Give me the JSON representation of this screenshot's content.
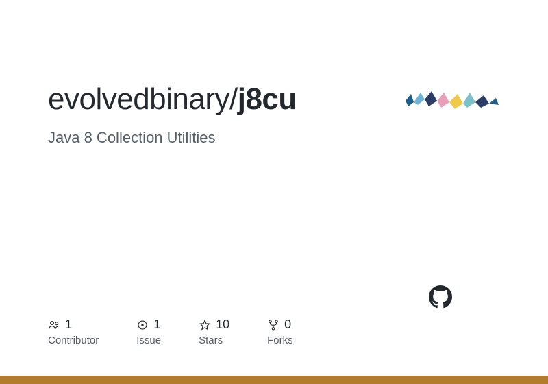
{
  "repo": {
    "owner": "evolvedbinary",
    "name": "j8cu",
    "description": "Java 8 Collection Utilities"
  },
  "stats": {
    "contributors": {
      "value": "1",
      "label": "Contributor"
    },
    "issues": {
      "value": "1",
      "label": "Issue"
    },
    "stars": {
      "value": "10",
      "label": "Stars"
    },
    "forks": {
      "value": "0",
      "label": "Forks"
    }
  },
  "accent_color": "#b17d2d"
}
